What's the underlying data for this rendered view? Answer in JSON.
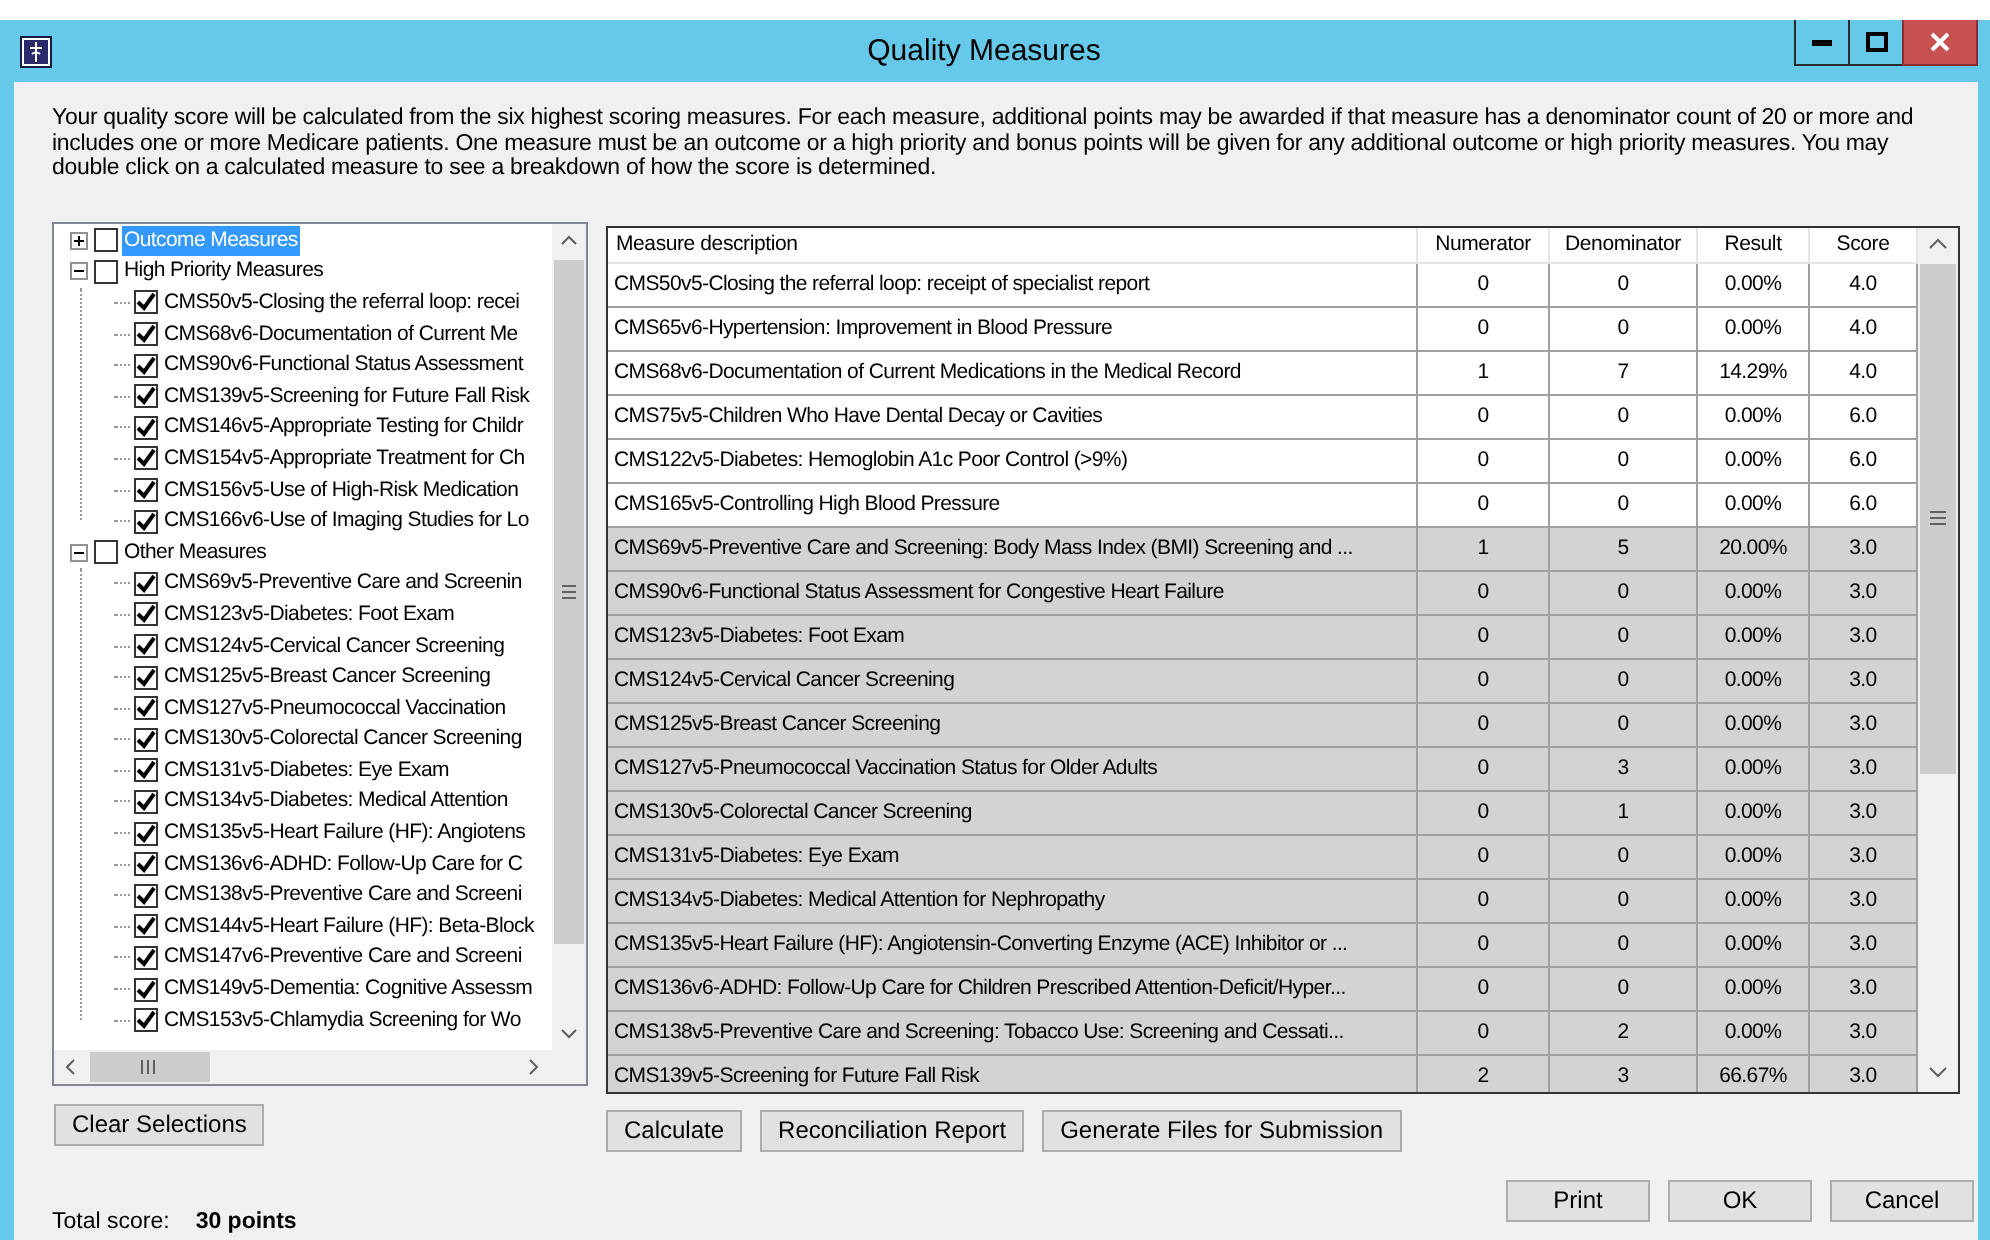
{
  "window": {
    "title": "Quality Measures"
  },
  "intro": "Your quality score will be calculated from the six highest scoring measures. For each measure, additional points may be awarded if that measure has a denominator count of 20 or more and includes one or more Medicare patients. One measure must be an outcome or a high priority and bonus points will be given for any additional outcome or high priority measures.  You may double click on a calculated measure to see a breakdown of how the score is determined.",
  "tree": [
    {
      "label": "Outcome Measures",
      "expanded": false,
      "checked": false,
      "selected": true
    },
    {
      "label": "High Priority Measures",
      "expanded": true,
      "checked": false,
      "selected": false,
      "children": [
        {
          "label": "CMS50v5-Closing the referral loop: recei",
          "checked": true
        },
        {
          "label": "CMS68v6-Documentation of Current Me",
          "checked": true
        },
        {
          "label": "CMS90v6-Functional Status Assessment",
          "checked": true
        },
        {
          "label": "CMS139v5-Screening for Future Fall Risk",
          "checked": true
        },
        {
          "label": "CMS146v5-Appropriate Testing for Childr",
          "checked": true
        },
        {
          "label": "CMS154v5-Appropriate Treatment for Ch",
          "checked": true
        },
        {
          "label": "CMS156v5-Use of High-Risk Medication",
          "checked": true
        },
        {
          "label": "CMS166v6-Use of Imaging Studies for Lo",
          "checked": true
        }
      ]
    },
    {
      "label": "Other Measures",
      "expanded": true,
      "checked": false,
      "selected": false,
      "children": [
        {
          "label": "CMS69v5-Preventive Care and Screenin",
          "checked": true
        },
        {
          "label": "CMS123v5-Diabetes: Foot Exam",
          "checked": true
        },
        {
          "label": "CMS124v5-Cervical Cancer Screening",
          "checked": true
        },
        {
          "label": "CMS125v5-Breast Cancer Screening",
          "checked": true
        },
        {
          "label": "CMS127v5-Pneumococcal Vaccination",
          "checked": true
        },
        {
          "label": "CMS130v5-Colorectal Cancer Screening",
          "checked": true
        },
        {
          "label": "CMS131v5-Diabetes: Eye Exam",
          "checked": true
        },
        {
          "label": "CMS134v5-Diabetes: Medical Attention",
          "checked": true
        },
        {
          "label": "CMS135v5-Heart Failure (HF): Angiotens",
          "checked": true
        },
        {
          "label": "CMS136v6-ADHD: Follow-Up Care for C",
          "checked": true
        },
        {
          "label": "CMS138v5-Preventive Care and Screeni",
          "checked": true
        },
        {
          "label": "CMS144v5-Heart Failure (HF): Beta-Block",
          "checked": true
        },
        {
          "label": "CMS147v6-Preventive Care and Screeni",
          "checked": true
        },
        {
          "label": "CMS149v5-Dementia: Cognitive Assessm",
          "checked": true
        },
        {
          "label": "CMS153v5-Chlamydia Screening for Wo",
          "checked": true
        }
      ]
    }
  ],
  "tree_buttons": [
    "Clear Selections"
  ],
  "table": {
    "columns": [
      "Measure description",
      "Numerator",
      "Denominator",
      "Result",
      "Score"
    ],
    "rows": [
      {
        "cells": [
          "CMS50v5-Closing the referral loop: receipt of specialist report",
          "0",
          "0",
          "0.00%",
          "4.0"
        ],
        "counted": true
      },
      {
        "cells": [
          "CMS65v6-Hypertension: Improvement in Blood Pressure",
          "0",
          "0",
          "0.00%",
          "4.0"
        ],
        "counted": true
      },
      {
        "cells": [
          "CMS68v6-Documentation of Current Medications in the Medical Record",
          "1",
          "7",
          "14.29%",
          "4.0"
        ],
        "counted": true
      },
      {
        "cells": [
          "CMS75v5-Children Who Have Dental Decay or Cavities",
          "0",
          "0",
          "0.00%",
          "6.0"
        ],
        "counted": true
      },
      {
        "cells": [
          "CMS122v5-Diabetes: Hemoglobin A1c Poor Control (>9%)",
          "0",
          "0",
          "0.00%",
          "6.0"
        ],
        "counted": true
      },
      {
        "cells": [
          "CMS165v5-Controlling High Blood Pressure",
          "0",
          "0",
          "0.00%",
          "6.0"
        ],
        "counted": true
      },
      {
        "cells": [
          "CMS69v5-Preventive Care and Screening: Body Mass Index (BMI) Screening and ...",
          "1",
          "5",
          "20.00%",
          "3.0"
        ],
        "counted": false
      },
      {
        "cells": [
          "CMS90v6-Functional Status Assessment for Congestive Heart Failure",
          "0",
          "0",
          "0.00%",
          "3.0"
        ],
        "counted": false
      },
      {
        "cells": [
          "CMS123v5-Diabetes: Foot Exam",
          "0",
          "0",
          "0.00%",
          "3.0"
        ],
        "counted": false
      },
      {
        "cells": [
          "CMS124v5-Cervical Cancer Screening",
          "0",
          "0",
          "0.00%",
          "3.0"
        ],
        "counted": false
      },
      {
        "cells": [
          "CMS125v5-Breast Cancer Screening",
          "0",
          "0",
          "0.00%",
          "3.0"
        ],
        "counted": false
      },
      {
        "cells": [
          "CMS127v5-Pneumococcal Vaccination Status for Older Adults",
          "0",
          "3",
          "0.00%",
          "3.0"
        ],
        "counted": false
      },
      {
        "cells": [
          "CMS130v5-Colorectal Cancer Screening",
          "0",
          "1",
          "0.00%",
          "3.0"
        ],
        "counted": false
      },
      {
        "cells": [
          "CMS131v5-Diabetes: Eye Exam",
          "0",
          "0",
          "0.00%",
          "3.0"
        ],
        "counted": false
      },
      {
        "cells": [
          "CMS134v5-Diabetes: Medical Attention for Nephropathy",
          "0",
          "0",
          "0.00%",
          "3.0"
        ],
        "counted": false
      },
      {
        "cells": [
          "CMS135v5-Heart Failure (HF): Angiotensin-Converting Enzyme (ACE) Inhibitor or  ...",
          "0",
          "0",
          "0.00%",
          "3.0"
        ],
        "counted": false
      },
      {
        "cells": [
          "CMS136v6-ADHD: Follow-Up Care for Children Prescribed Attention-Deficit/Hyper...",
          "0",
          "0",
          "0.00%",
          "3.0"
        ],
        "counted": false
      },
      {
        "cells": [
          "CMS138v5-Preventive Care and Screening: Tobacco Use: Screening and Cessati...",
          "0",
          "2",
          "0.00%",
          "3.0"
        ],
        "counted": false
      },
      {
        "cells": [
          "CMS139v5-Screening for Future Fall Risk",
          "2",
          "3",
          "66.67%",
          "3.0"
        ],
        "counted": false
      }
    ]
  },
  "table_buttons": [
    "Calculate",
    "Reconciliation Report",
    "Generate Files for Submission"
  ],
  "total": {
    "label": "Total score:",
    "value": "30 points"
  },
  "dialog_buttons": [
    "Print",
    "OK",
    "Cancel"
  ]
}
